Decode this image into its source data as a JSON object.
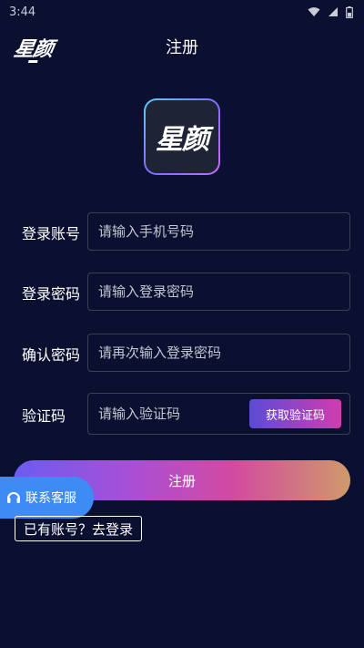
{
  "status_bar": {
    "time": "3:44"
  },
  "header": {
    "logo_text": "星颜",
    "title": "注册"
  },
  "app_icon": {
    "text": "星颜"
  },
  "form": {
    "account": {
      "label": "登录账号",
      "placeholder": "请输入手机号码",
      "value": ""
    },
    "password": {
      "label": "登录密码",
      "placeholder": "请输入登录密码",
      "value": ""
    },
    "confirm": {
      "label": "确认密码",
      "placeholder": "请再次输入登录密码",
      "value": ""
    },
    "code": {
      "label": "验证码",
      "placeholder": "请输入验证码",
      "value": "",
      "button_label": "获取验证码"
    }
  },
  "register_button_label": "注册",
  "support_label": "联系客服",
  "login_link_label": "已有账号？去登录",
  "icons": {
    "wifi": "wifi-icon",
    "signal": "signal-icon",
    "battery": "battery-icon",
    "support": "headset-icon"
  },
  "colors": {
    "background": "#0b1030",
    "accent_blue": "#3d8cf5",
    "gradient_start": "#6b5cf0",
    "gradient_end": "#cf9a6a"
  }
}
